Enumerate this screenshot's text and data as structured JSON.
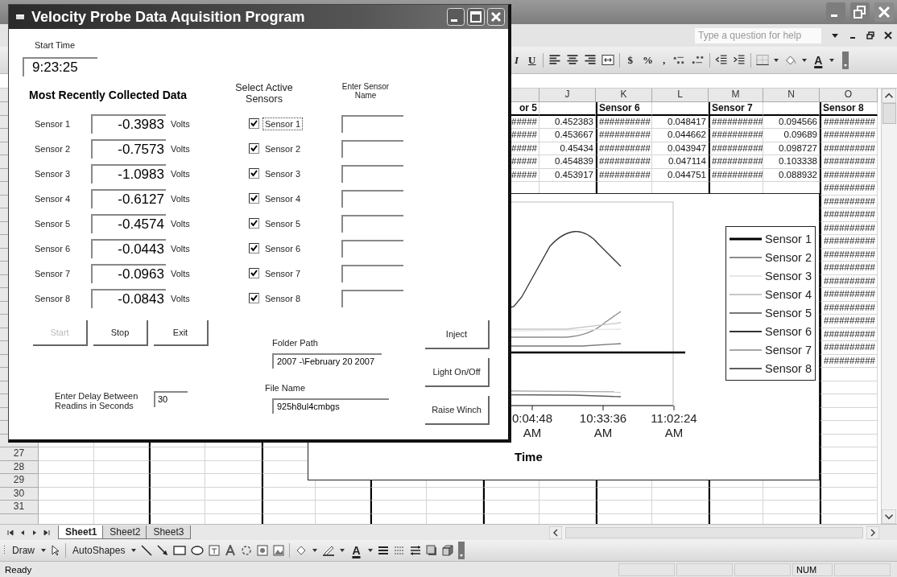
{
  "excel": {
    "help_placeholder": "Type a question for help",
    "font_style_buttons": [
      "I",
      "U"
    ],
    "number_format_buttons": [
      "$",
      "%",
      ","
    ],
    "font_color_glyph": "A",
    "sheet": {
      "columns": [
        "J",
        "K",
        "L",
        "M",
        "N",
        "O"
      ],
      "sensor_headers": [
        "or 5",
        "Sensor 6",
        "Sensor 7",
        "Sensor 8"
      ],
      "data_rows": [
        [
          "#####",
          "0.452383",
          "##########",
          "0.048417",
          "##########",
          "0.094566",
          "##########"
        ],
        [
          "#####",
          "0.453667",
          "##########",
          "0.044662",
          "##########",
          "0.09689",
          "##########"
        ],
        [
          "#####",
          "0.45434",
          "##########",
          "0.043947",
          "##########",
          "0.098727",
          "##########"
        ],
        [
          "#####",
          "0.454839",
          "##########",
          "0.047114",
          "##########",
          "0.103338",
          "##########"
        ],
        [
          "#####",
          "0.453917",
          "##########",
          "0.044751",
          "##########",
          "0.088932",
          "##########"
        ]
      ],
      "overflow_cells": [
        "##########",
        "##########",
        "##########",
        "##########",
        "##########",
        "##########",
        "##########",
        "##########",
        "##########",
        "##########",
        "##########",
        "##########",
        "##########",
        "##########"
      ],
      "row_numbers": [
        "27",
        "28",
        "29",
        "30",
        "31"
      ]
    },
    "chart": {
      "x_tick_labels": [
        {
          "time": "0:04:48",
          "period": "AM"
        },
        {
          "time": "10:33:36",
          "period": "AM"
        },
        {
          "time": "11:02:24",
          "period": "AM"
        }
      ],
      "x_axis_title": "Time",
      "legend": [
        {
          "label": "Sensor 1",
          "color": "#000000"
        },
        {
          "label": "Sensor 2",
          "color": "#8c8c8c"
        },
        {
          "label": "Sensor 3",
          "color": "#e6e6e6"
        },
        {
          "label": "Sensor 4",
          "color": "#c8c8c8"
        },
        {
          "label": "Sensor 5",
          "color": "#777777"
        },
        {
          "label": "Sensor 6",
          "color": "#333333"
        },
        {
          "label": "Sensor 7",
          "color": "#a6a6a6"
        },
        {
          "label": "Sensor 8",
          "color": "#5e5e5e"
        }
      ]
    },
    "sheet_tabs": [
      {
        "label": "Sheet1",
        "selected": true
      },
      {
        "label": "Sheet2",
        "selected": false
      },
      {
        "label": "Sheet3",
        "selected": false
      }
    ],
    "draw_toolbar": {
      "draw_label": "Draw",
      "autoshapes_label": "AutoShapes",
      "font_color_glyph": "A"
    },
    "status_bar": {
      "text": "Ready",
      "indicators": [
        "NUM"
      ]
    }
  },
  "dialog": {
    "title": "Velocity Probe Data Aquisition Program",
    "start_time_label": "Start Time",
    "start_time": "9:23:25",
    "data_heading": "Most Recently Collected Data",
    "select_heading": "Select Active Sensors",
    "name_heading": "Enter Sensor Name",
    "sensors": [
      {
        "label": "Sensor 1",
        "reading": "-0.3983",
        "unit": "Volts",
        "checkbox_label": "Sensor 1",
        "checked": true,
        "focused": true
      },
      {
        "label": "Sensor 2",
        "reading": "-0.7573",
        "unit": "Volts",
        "checkbox_label": "Sensor 2",
        "checked": true,
        "focused": false
      },
      {
        "label": "Sensor 3",
        "reading": "-1.0983",
        "unit": "Volts",
        "checkbox_label": "Sensor 3",
        "checked": true,
        "focused": false
      },
      {
        "label": "Sensor 4",
        "reading": "-0.6127",
        "unit": "Volts",
        "checkbox_label": "Sensor 4",
        "checked": true,
        "focused": false
      },
      {
        "label": "Sensor 5",
        "reading": "-0.4574",
        "unit": "Volts",
        "checkbox_label": "Sensor 5",
        "checked": true,
        "focused": false
      },
      {
        "label": "Sensor 6",
        "reading": "-0.0443",
        "unit": "Volts",
        "checkbox_label": "Sensor 6",
        "checked": true,
        "focused": false
      },
      {
        "label": "Sensor 7",
        "reading": "-0.0963",
        "unit": "Volts",
        "checkbox_label": "Sensor 7",
        "checked": true,
        "focused": false
      },
      {
        "label": "Sensor 8",
        "reading": "-0.0843",
        "unit": "Volts",
        "checkbox_label": "Sensor 8",
        "checked": true,
        "focused": false
      }
    ],
    "buttons": [
      {
        "label": "Start",
        "disabled": true
      },
      {
        "label": "Stop",
        "disabled": false
      },
      {
        "label": "Exit",
        "disabled": false
      }
    ],
    "delay_label": "Enter Delay Between Readins in Seconds",
    "delay_value": "30",
    "folder_label": "Folder Path",
    "folder_value": "2007 -\\February 20 2007",
    "file_label": "File Name",
    "file_value": "925h8ul4cmbgs",
    "action_buttons": [
      {
        "label": "Inject"
      },
      {
        "label": "Light On/Off"
      },
      {
        "label": "Raise Winch"
      }
    ]
  }
}
